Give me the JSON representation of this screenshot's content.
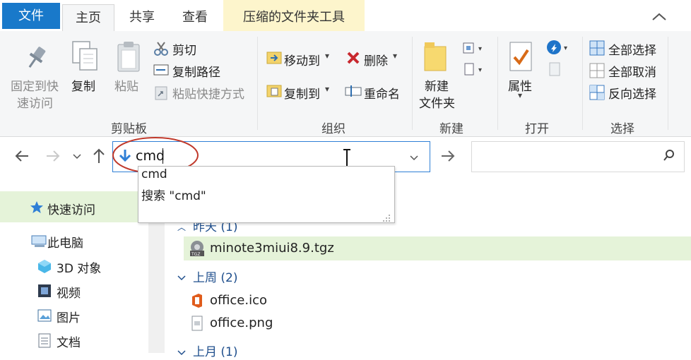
{
  "tabs": {
    "file": "文件",
    "home": "主页",
    "share": "共享",
    "view": "查看",
    "tools": "压缩的文件夹工具"
  },
  "ribbon": {
    "clipboard": {
      "pin": [
        "固定到快",
        "速访问"
      ],
      "copy": "复制",
      "paste": "粘贴",
      "cut": "剪切",
      "copy_path": "复制路径",
      "paste_shortcut": "粘贴快捷方式",
      "label": "剪贴板"
    },
    "organize": {
      "move_to": "移动到",
      "copy_to": "复制到",
      "delete": "删除",
      "rename": "重命名",
      "label": "组织"
    },
    "new": {
      "new_folder": [
        "新建",
        "文件夹"
      ],
      "label": "新建"
    },
    "open": {
      "properties": "属性",
      "label": "打开"
    },
    "select": {
      "select_all": "全部选择",
      "select_none": "全部取消",
      "invert": "反向选择",
      "label": "选择"
    }
  },
  "address": {
    "value": "cmd"
  },
  "suggestions": [
    "cmd",
    "搜索 \"cmd\""
  ],
  "sidebar": {
    "quick_access": "快速访问",
    "this_pc": "此电脑",
    "objects_3d": "3D 对象",
    "videos": "视频",
    "pictures": "图片",
    "documents": "文档"
  },
  "content": {
    "group_yesterday": "昨天 (1)",
    "file1": "minote3miui8.9.tgz",
    "group_last_week": "上周 (2)",
    "file2": "office.ico",
    "file3": "office.png",
    "group_last_month": "上月 (1)"
  },
  "colors": {
    "accent": "#1979ca",
    "annotation": "#c0392b",
    "tools_tab": "#fdf5cc",
    "selection": "#e5f3d9"
  }
}
